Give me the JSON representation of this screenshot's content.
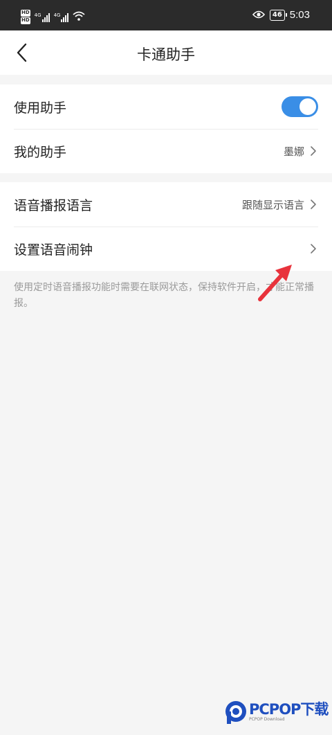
{
  "status_bar": {
    "sim_badges": [
      "HD",
      "HD"
    ],
    "sim1_tech": "4G",
    "sim2_tech": "4G",
    "battery": "46",
    "time": "5:03",
    "icons": [
      "signal-icon",
      "wifi-icon",
      "eye-icon",
      "battery-icon"
    ]
  },
  "nav": {
    "title": "卡通助手",
    "back_icon": "chevron-left-icon"
  },
  "section1": {
    "use_assistant": {
      "label": "使用助手",
      "enabled": true
    },
    "my_assistant": {
      "label": "我的助手",
      "value": "墨娜"
    }
  },
  "section2": {
    "voice_language": {
      "label": "语音播报语言",
      "value": "跟随显示语言"
    },
    "voice_alarm": {
      "label": "设置语音闹钟"
    }
  },
  "note": "使用定时语音播报功能时需要在联网状态，保持软件开启，才能正常播报。",
  "annotation": {
    "icon": "red-arrow-icon",
    "color": "#e8333c"
  },
  "colors": {
    "accent": "#3a8ee6",
    "status_bar_bg": "#2b2b2b",
    "page_bg": "#f5f5f5"
  },
  "watermark": {
    "brand": "PCPOP下载",
    "sub": "PCPOP Download"
  }
}
